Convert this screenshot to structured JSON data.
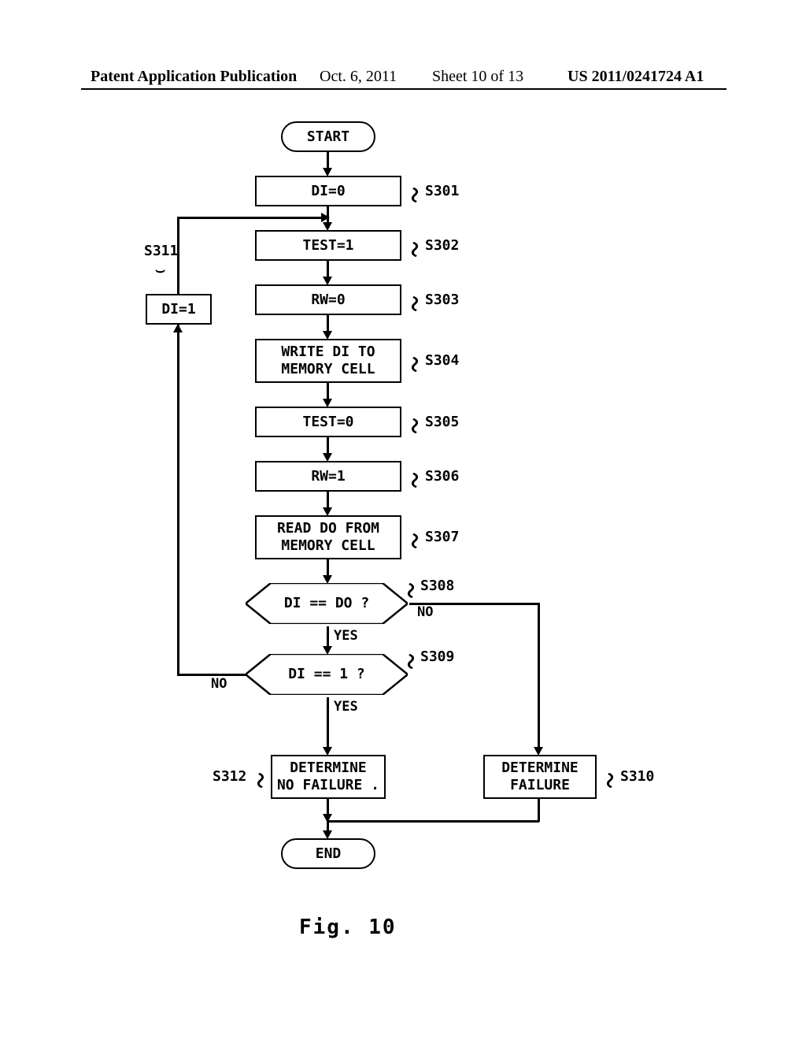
{
  "header": {
    "left": "Patent Application Publication",
    "date": "Oct. 6, 2011",
    "sheet": "Sheet 10 of 13",
    "pubnum": "US 2011/0241724 A1"
  },
  "flow": {
    "start": "START",
    "s301": "DI=0",
    "s302": "TEST=1",
    "s303": "RW=0",
    "s304_l1": "WRITE DI TO",
    "s304_l2": "MEMORY CELL",
    "s305": "TEST=0",
    "s306": "RW=1",
    "s307_l1": "READ DO FROM",
    "s307_l2": "MEMORY CELL",
    "s308": "DI == DO ?",
    "s309": "DI == 1 ?",
    "s310_l1": "DETERMINE",
    "s310_l2": "FAILURE",
    "s311": "DI=1",
    "s312_l1": "DETERMINE",
    "s312_l2": "NO FAILURE .",
    "end": "END"
  },
  "labels": {
    "s301": "S301",
    "s302": "S302",
    "s303": "S303",
    "s304": "S304",
    "s305": "S305",
    "s306": "S306",
    "s307": "S307",
    "s308": "S308",
    "s309": "S309",
    "s310": "S310",
    "s311": "S311",
    "s312": "S312",
    "yes": "YES",
    "no": "NO"
  },
  "figure": "Fig. 10"
}
